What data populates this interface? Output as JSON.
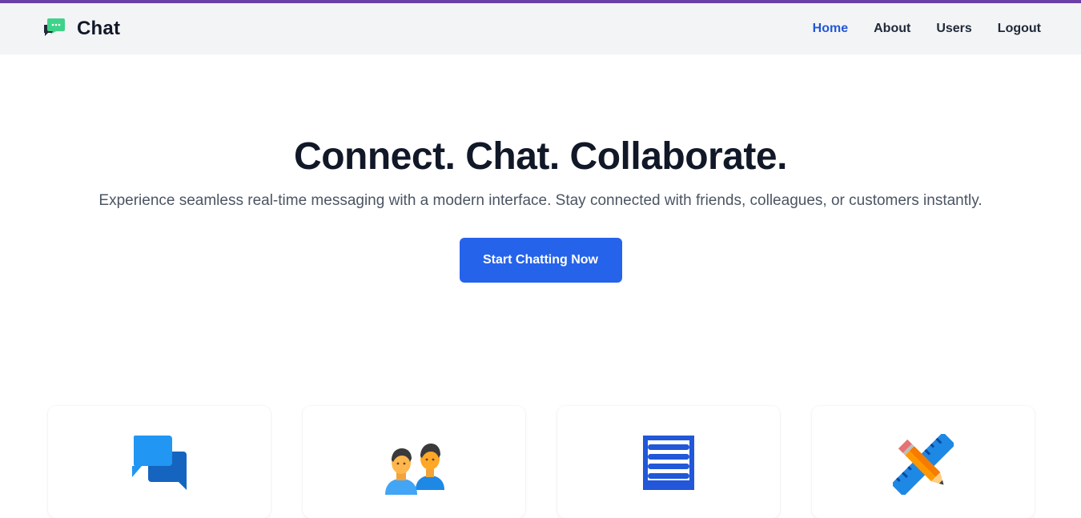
{
  "brand": {
    "name": "Chat",
    "icon": "chat-bubble-icon"
  },
  "nav": {
    "items": [
      {
        "label": "Home",
        "active": true
      },
      {
        "label": "About",
        "active": false
      },
      {
        "label": "Users",
        "active": false
      },
      {
        "label": "Logout",
        "active": false
      }
    ]
  },
  "hero": {
    "title": "Connect. Chat. Collaborate.",
    "subtitle": "Experience seamless real-time messaging with a modern interface. Stay connected with friends, colleagues, or customers instantly.",
    "cta_label": "Start Chatting Now"
  },
  "features": [
    {
      "icon": "speech-bubbles-icon"
    },
    {
      "icon": "users-icon"
    },
    {
      "icon": "document-list-icon"
    },
    {
      "icon": "pencil-ruler-icon"
    }
  ],
  "colors": {
    "accent_bar": "#6b40a8",
    "nav_active": "#2158d6",
    "cta": "#2563eb",
    "brand_icon": "#3fd38a"
  }
}
